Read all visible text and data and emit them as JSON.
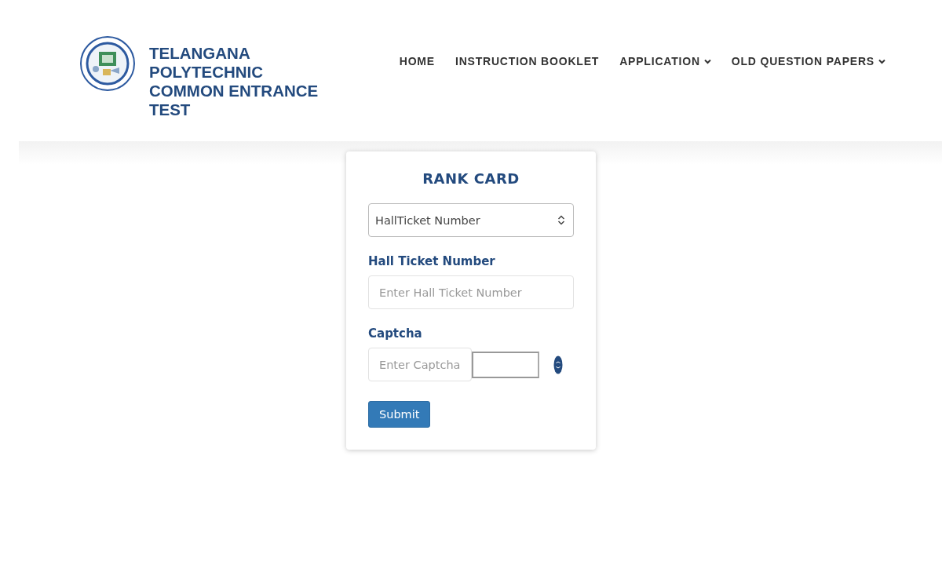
{
  "header": {
    "title": "TELANGANA POLYTECHNIC COMMON ENTRANCE TEST",
    "nav": [
      {
        "label": "HOME",
        "has_menu": false
      },
      {
        "label": "INSTRUCTION BOOKLET",
        "has_menu": false
      },
      {
        "label": "APPLICATION",
        "has_menu": true
      },
      {
        "label": "OLD QUESTION PAPERS",
        "has_menu": true
      }
    ]
  },
  "form": {
    "title": "RANK CARD",
    "search_by": "HallTicket Number",
    "fields": [
      {
        "label": "Hall Ticket Number",
        "placeholder": "Enter Hall Ticket Number"
      }
    ],
    "captcha": {
      "label": "Captcha",
      "placeholder": "Enter Captcha"
    },
    "submit": "Submit"
  }
}
